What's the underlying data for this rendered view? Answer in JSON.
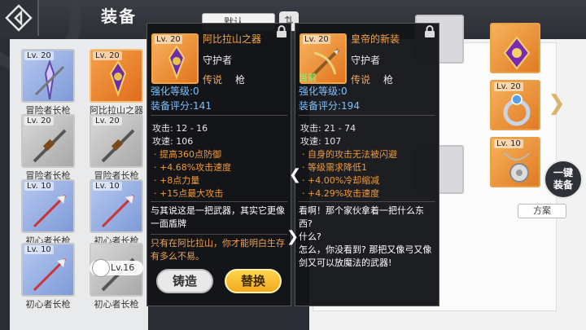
{
  "header": {
    "title": "装备",
    "filter_value": "默认"
  },
  "inventory": [
    {
      "level": "Lv. 20",
      "label": "冒险者长枪",
      "rarity": "blue"
    },
    {
      "level": "Lv. 20",
      "label": "阿比拉山之器",
      "rarity": "orange"
    },
    {
      "level": "Lv. 20",
      "label": "冒险者长枪",
      "rarity": "gray"
    },
    {
      "level": "Lv. 20",
      "label": "冒险者长枪",
      "rarity": "gray"
    },
    {
      "level": "Lv. 10",
      "label": "初心者长枪",
      "rarity": "blue"
    },
    {
      "level": "Lv. 10",
      "label": "初心者长枪",
      "rarity": "blue"
    },
    {
      "level": "Lv. 10",
      "label": "初心者长枪",
      "rarity": "blue"
    },
    {
      "level": "",
      "label": "初心者长枪",
      "rarity": "gray"
    }
  ],
  "owner_badge": "Lv.16",
  "card_left": {
    "level": "Lv. 20",
    "name": "阿比拉山之器",
    "role": "守护者",
    "rarity": "传说",
    "weapon_type": "枪",
    "enhance": "强化等级:0",
    "score": "装备评分:141",
    "attack": "攻击:  12  -  16",
    "speed": "攻速:  106",
    "bonuses": [
      "提高360点防御",
      "+4.68%攻击速度",
      "+8点力量",
      "+15点最大攻击"
    ],
    "desc": "与其说这是一把武器，其实它更像一面盾牌",
    "lore": "只有在阿比拉山，你才能明白生存有多么不易。"
  },
  "card_right": {
    "level": "Lv. 20",
    "name": "皇帝的新装",
    "role": "守护者",
    "rarity": "传说",
    "weapon_type": "枪",
    "current": "当前",
    "enhance": "强化等级:0",
    "score": "装备评分:194",
    "attack": "攻击:  21  -  74",
    "speed": "攻速:  107",
    "bonuses": [
      "自身的攻击无法被闪避",
      "等级需求降低1",
      "+4.00%冷却缩减",
      "+4.29%攻击速度"
    ],
    "desc": "看啊！那个家伙拿着一把什么东西?\n什么?\n怎么，你没看到? 那把又像弓又像剑又可以放魔法的武器!"
  },
  "buttons": {
    "forge": "铸造",
    "replace": "替换",
    "equip_all": "一键\n装备",
    "scheme": "方案"
  },
  "side_slots": [
    {
      "level": ""
    },
    {
      "level": "Lv. 20"
    },
    {
      "level": "Lv. 10"
    }
  ]
}
